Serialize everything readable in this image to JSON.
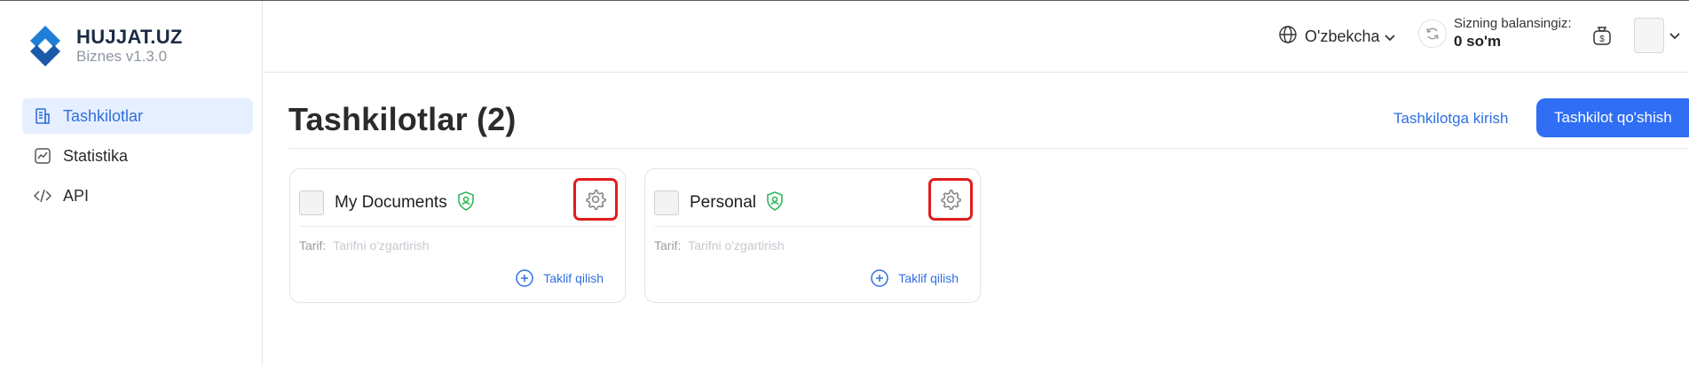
{
  "app": {
    "name": "HUJJAT.UZ",
    "version": "Biznes v1.3.0",
    "brand_color": "#2f6ef5"
  },
  "sidebar": {
    "items": [
      {
        "label": "Tashkilotlar",
        "icon": "building-icon",
        "active": true
      },
      {
        "label": "Statistika",
        "icon": "chart-icon",
        "active": false
      },
      {
        "label": "API",
        "icon": "code-icon",
        "active": false
      }
    ]
  },
  "header": {
    "language": "O'zbekcha",
    "balance_label": "Sizning balansingiz:",
    "balance_value": "0 so'm"
  },
  "main": {
    "title": "Tashkilotlar (2)",
    "enter_org_link": "Tashkilotga kirish",
    "add_org_button": "Tashkilot qo'shish",
    "cards": [
      {
        "name": "My Documents",
        "tarif_label": "Tarif:",
        "tarif_link": "Tarifni o'zgartirish",
        "invite": "Taklif qilish"
      },
      {
        "name": "Personal",
        "tarif_label": "Tarif:",
        "tarif_link": "Tarifni o'zgartirish",
        "invite": "Taklif qilish"
      }
    ]
  },
  "colors": {
    "accent": "#2f6fe0",
    "active_bg": "#e6efff",
    "verified": "#2fb85c",
    "highlight": "#e11c1c"
  }
}
